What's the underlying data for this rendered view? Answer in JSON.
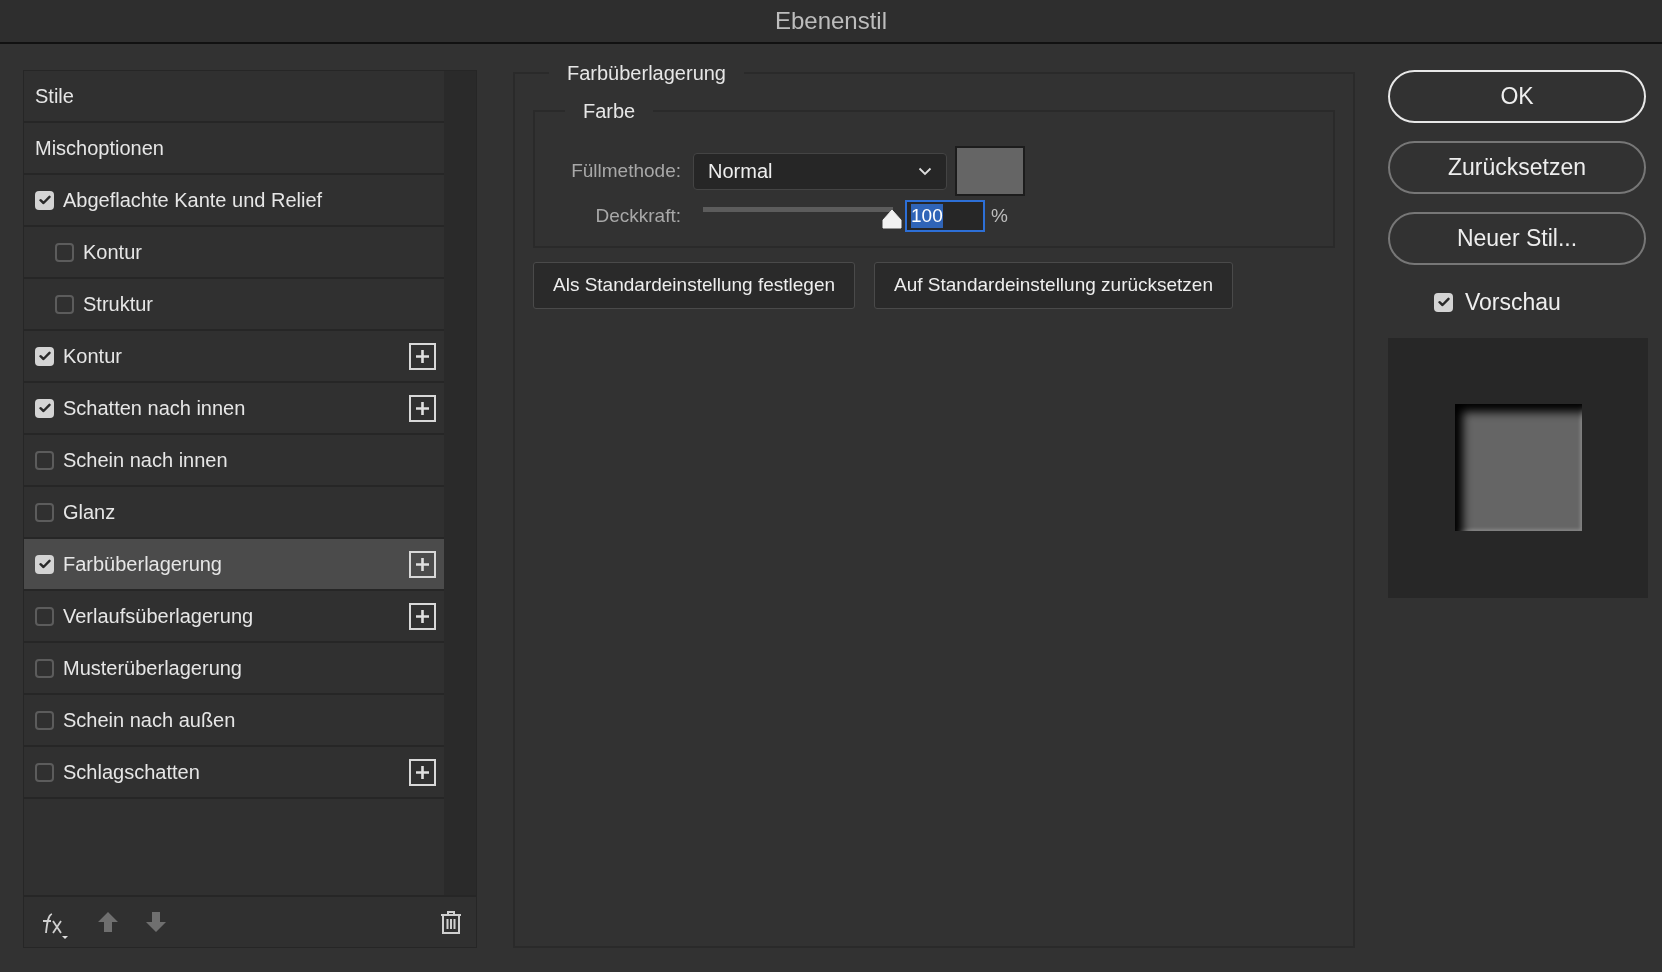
{
  "window": {
    "title": "Ebenenstil"
  },
  "styles_list": [
    {
      "kind": "header",
      "label": "Stile",
      "selected": false
    },
    {
      "kind": "header",
      "label": "Mischoptionen",
      "selected": false
    },
    {
      "kind": "effect",
      "label": "Abgeflachte Kante und Relief",
      "checked": true,
      "selected": false,
      "addable": false,
      "children": [
        {
          "kind": "effect",
          "label": "Kontur",
          "checked": false,
          "selected": false,
          "addable": false
        },
        {
          "kind": "effect",
          "label": "Struktur",
          "checked": false,
          "selected": false,
          "addable": false
        }
      ]
    },
    {
      "kind": "effect",
      "label": "Kontur",
      "checked": true,
      "selected": false,
      "addable": true
    },
    {
      "kind": "effect",
      "label": "Schatten nach innen",
      "checked": true,
      "selected": false,
      "addable": true
    },
    {
      "kind": "effect",
      "label": "Schein nach innen",
      "checked": false,
      "selected": false,
      "addable": false
    },
    {
      "kind": "effect",
      "label": "Glanz",
      "checked": false,
      "selected": false,
      "addable": false
    },
    {
      "kind": "effect",
      "label": "Farbüberlagerung",
      "checked": true,
      "selected": true,
      "addable": true
    },
    {
      "kind": "effect",
      "label": "Verlaufsüberlagerung",
      "checked": false,
      "selected": false,
      "addable": true
    },
    {
      "kind": "effect",
      "label": "Musterüberlagerung",
      "checked": false,
      "selected": false,
      "addable": false
    },
    {
      "kind": "effect",
      "label": "Schein nach außen",
      "checked": false,
      "selected": false,
      "addable": false
    },
    {
      "kind": "effect",
      "label": "Schlagschatten",
      "checked": false,
      "selected": false,
      "addable": true
    }
  ],
  "settings": {
    "title": "Farbüberlagerung",
    "group": "Farbe",
    "blend_mode": {
      "label": "Füllmethode:",
      "value": "Normal",
      "color": "#656565"
    },
    "opacity": {
      "label": "Deckkraft:",
      "level": 1,
      "value": "100",
      "unit": "%"
    },
    "buttons": [
      "Als Standardeinstellung festlegen",
      "Auf Standardeinstellung zurücksetzen"
    ]
  },
  "actions": [
    {
      "label": "OK",
      "default": true
    },
    {
      "label": "Zurücksetzen",
      "default": false
    },
    {
      "label": "Neuer Stil...",
      "default": false
    }
  ],
  "preview": {
    "label": "Vorschau",
    "checked": true
  }
}
